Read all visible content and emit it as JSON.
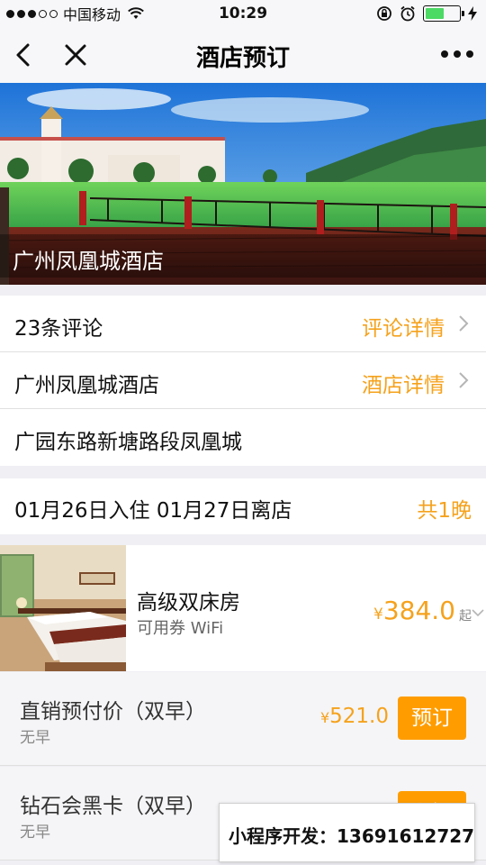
{
  "status_bar": {
    "carrier": "中国移动",
    "time": "10:29"
  },
  "nav": {
    "title": "酒店预订"
  },
  "hero": {
    "hotel_name": "广州凤凰城酒店"
  },
  "info": {
    "reviews_label": "23条评论",
    "reviews_link": "评论详情",
    "hotel_label": "广州凤凰城酒店",
    "hotel_link": "酒店详情",
    "address": "广园东路新塘路段凤凰城"
  },
  "stay": {
    "dates": "01月26日入住  01月27日离店",
    "nights": "共1晚"
  },
  "room": {
    "name": "高级双床房",
    "amenities": "可用券  WiFi",
    "currency": "¥",
    "price": "384.0",
    "price_suffix": "起"
  },
  "plans": [
    {
      "name": "直销预付价（双早）",
      "meal": "无早",
      "currency": "¥",
      "price": "521.0",
      "book_label": "预订"
    },
    {
      "name": "钻石会黑卡（双早）",
      "meal": "无早",
      "book_label": "预订"
    }
  ],
  "promo": {
    "text": "小程序开发：13691612727"
  },
  "colors": {
    "accent": "#f5a21c",
    "book_button": "#ff9d00",
    "battery": "#4cd964"
  }
}
